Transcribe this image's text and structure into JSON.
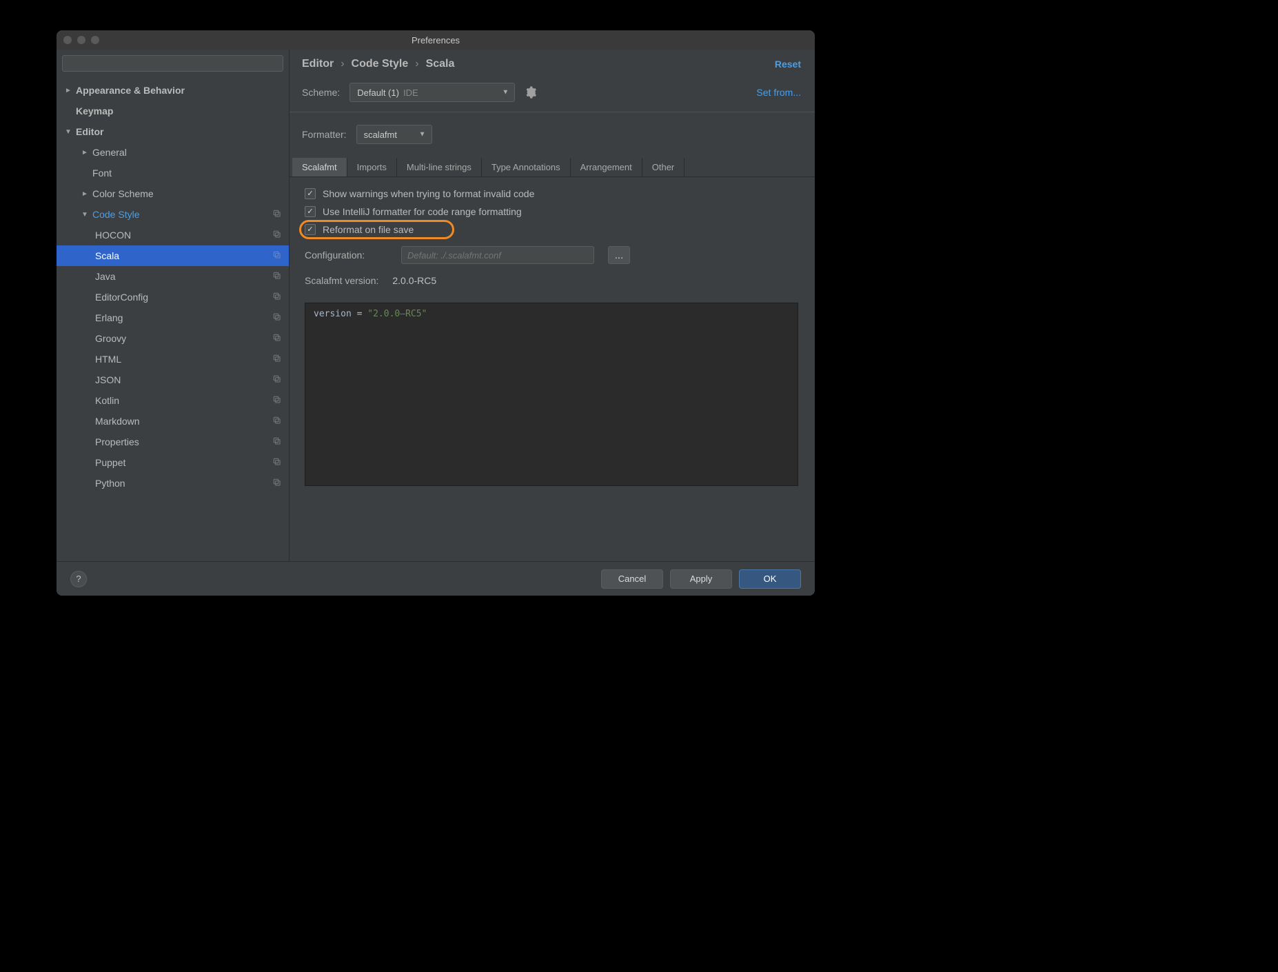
{
  "window_title": "Preferences",
  "sidebar": {
    "search_placeholder": "",
    "items": [
      {
        "label": "Appearance & Behavior",
        "depth": 0,
        "arrow": "►",
        "bold": true
      },
      {
        "label": "Keymap",
        "depth": 0,
        "arrow": "",
        "bold": true,
        "indent_for_arrow": true
      },
      {
        "label": "Editor",
        "depth": 0,
        "arrow": "▼",
        "bold": true
      },
      {
        "label": "General",
        "depth": 1,
        "arrow": "►"
      },
      {
        "label": "Font",
        "depth": 1,
        "arrow": "",
        "indent_for_arrow": true
      },
      {
        "label": "Color Scheme",
        "depth": 1,
        "arrow": "►"
      },
      {
        "label": "Code Style",
        "depth": 1,
        "arrow": "▼",
        "active_text": true,
        "icon": true
      },
      {
        "label": "HOCON",
        "depth": 2,
        "icon": true
      },
      {
        "label": "Scala",
        "depth": 2,
        "selected": true,
        "icon": true
      },
      {
        "label": "Java",
        "depth": 2,
        "icon": true
      },
      {
        "label": "EditorConfig",
        "depth": 2,
        "icon": true
      },
      {
        "label": "Erlang",
        "depth": 2,
        "icon": true
      },
      {
        "label": "Groovy",
        "depth": 2,
        "icon": true
      },
      {
        "label": "HTML",
        "depth": 2,
        "icon": true
      },
      {
        "label": "JSON",
        "depth": 2,
        "icon": true
      },
      {
        "label": "Kotlin",
        "depth": 2,
        "icon": true
      },
      {
        "label": "Markdown",
        "depth": 2,
        "icon": true
      },
      {
        "label": "Properties",
        "depth": 2,
        "icon": true
      },
      {
        "label": "Puppet",
        "depth": 2,
        "icon": true
      },
      {
        "label": "Python",
        "depth": 2,
        "icon": true
      }
    ]
  },
  "breadcrumb": [
    "Editor",
    "Code Style",
    "Scala"
  ],
  "reset_label": "Reset",
  "scheme": {
    "label": "Scheme:",
    "value": "Default (1)",
    "scope": "IDE",
    "set_from": "Set from..."
  },
  "formatter": {
    "label": "Formatter:",
    "value": "scalafmt"
  },
  "tabs": [
    "Scalafmt",
    "Imports",
    "Multi-line strings",
    "Type Annotations",
    "Arrangement",
    "Other"
  ],
  "active_tab_index": 0,
  "checkboxes": {
    "show_warnings": {
      "label": "Show warnings when trying to format invalid code",
      "checked": true
    },
    "use_intellij": {
      "label": "Use IntelliJ formatter for code range formatting",
      "checked": true
    },
    "reformat_on_save": {
      "label": "Reformat on file save",
      "checked": true
    }
  },
  "configuration": {
    "label": "Configuration:",
    "placeholder": "Default: ./.scalafmt.conf",
    "browse_label": "..."
  },
  "version": {
    "label": "Scalafmt version:",
    "value": "2.0.0-RC5"
  },
  "code": {
    "key": "version",
    "value": "\"2.0.0–RC5\""
  },
  "footer": {
    "help": "?",
    "cancel": "Cancel",
    "apply": "Apply",
    "ok": "OK"
  }
}
